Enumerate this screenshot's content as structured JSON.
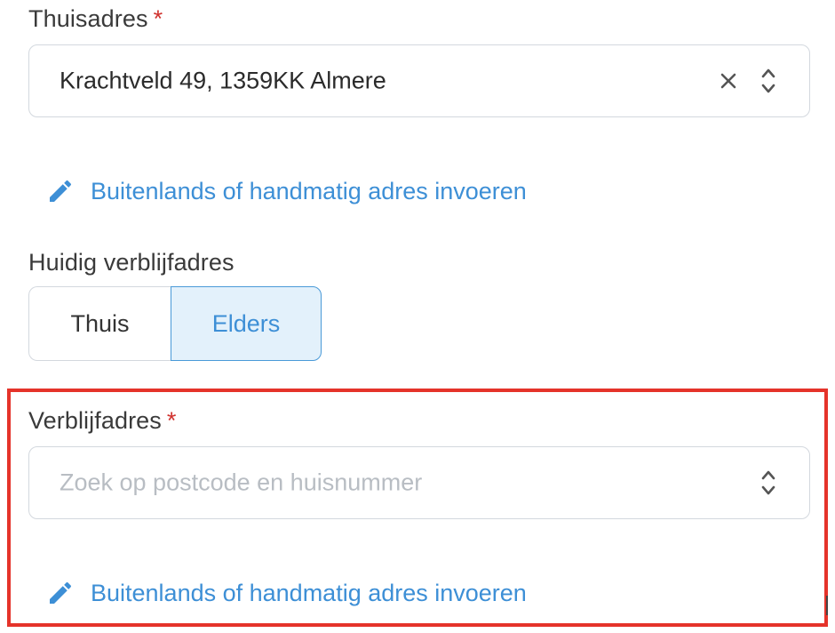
{
  "home_address": {
    "label": "Thuisadres",
    "required_mark": "*",
    "value": "Krachtveld 49, 1359KK Almere",
    "manual_link": "Buitenlands of handmatig adres invoeren"
  },
  "current_residence": {
    "label": "Huidig verblijfadres",
    "options": [
      "Thuis",
      "Elders"
    ],
    "selected": "Elders"
  },
  "residence_address": {
    "label": "Verblijfadres",
    "required_mark": "*",
    "placeholder": "Zoek op postcode en huisnummer",
    "manual_link": "Buitenlands of handmatig adres invoeren"
  },
  "colors": {
    "link": "#3d8fd6",
    "required": "#d0312d",
    "highlight": "#e5332a",
    "selected_bg": "#e3f1fb"
  },
  "icons": [
    "clear-icon",
    "chevron-updown-icon",
    "pencil-icon"
  ]
}
